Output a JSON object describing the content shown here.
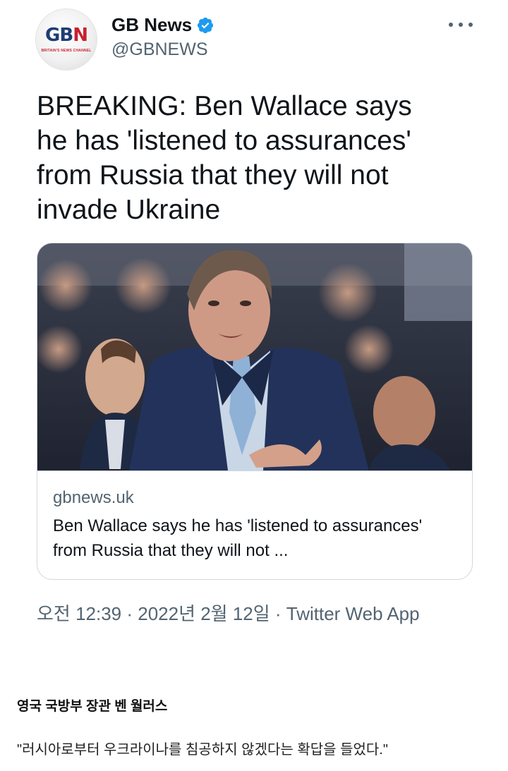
{
  "tweet": {
    "avatar": {
      "logo_text": "GB",
      "logo_accent": "N",
      "logo_sub": "BRITAIN'S NEWS CHANNEL"
    },
    "display_name": "GB News",
    "handle": "@GBNEWS",
    "text": "BREAKING: Ben Wallace says\nhe has 'listened to assurances'\nfrom Russia that they will not\ninvade Ukraine",
    "card": {
      "domain": "gbnews.uk",
      "title": "Ben Wallace says he has 'listened to assurances' from Russia that they will not ..."
    },
    "timestamp": "오전 12:39 · 2022년 2월 12일 · ",
    "source": "Twitter Web App"
  },
  "caption": {
    "title": "영국 국방부 장관 벤 월러스",
    "quote": "\"러시아로부터 우크라이나를 침공하지 않겠다는 확답을 들었다.\""
  },
  "icons": {
    "verified": "verified-badge-icon",
    "more": "more-options-icon"
  },
  "colors": {
    "text": "#0f1419",
    "secondary": "#536471",
    "verified": "#1d9bf0",
    "border": "#cfd9de"
  }
}
